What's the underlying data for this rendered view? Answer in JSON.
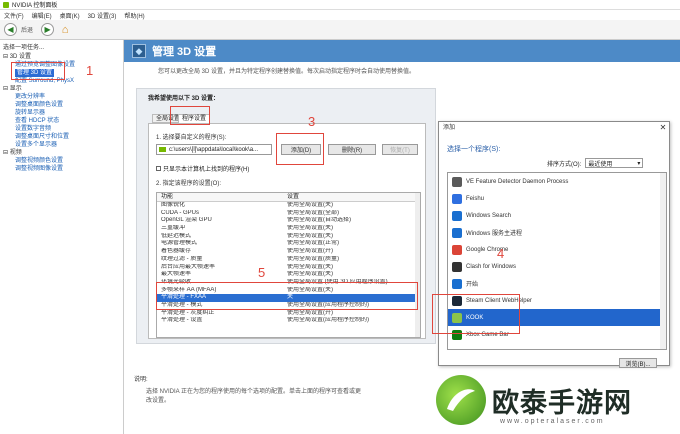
{
  "window": {
    "title": "NVIDIA 控制面板"
  },
  "menu": [
    "文件(F)",
    "编辑(E)",
    "桌面(K)",
    "3D 设置(3)",
    "帮助(H)"
  ],
  "toolbar": {
    "back_label": "后退",
    "forward_label": ""
  },
  "sidebar": {
    "title": "选择一项任务...",
    "items": [
      {
        "label": "3D 设置",
        "kind": "cat"
      },
      {
        "label": "通过预览调整图像设置",
        "kind": "link"
      },
      {
        "label": "管理 3D 设置",
        "kind": "selected"
      },
      {
        "label": "配置 Surround, PhysX",
        "kind": "link"
      },
      {
        "label": "显示",
        "kind": "cat"
      },
      {
        "label": "更改分辨率",
        "kind": "link"
      },
      {
        "label": "调整桌面颜色设置",
        "kind": "link"
      },
      {
        "label": "旋转显示器",
        "kind": "link"
      },
      {
        "label": "查看 HDCP 状态",
        "kind": "link"
      },
      {
        "label": "设置数字音频",
        "kind": "link"
      },
      {
        "label": "调整桌面尺寸和位置",
        "kind": "link"
      },
      {
        "label": "设置多个显示器",
        "kind": "link"
      },
      {
        "label": "视频",
        "kind": "cat"
      },
      {
        "label": "调整视频颜色设置",
        "kind": "link"
      },
      {
        "label": "调整视频图像设置",
        "kind": "link"
      }
    ]
  },
  "banner": {
    "title": "管理 3D 设置"
  },
  "description": "您可以更改全局 3D 设置，并且为特定程序创建替换值。每次启动指定程序时会自动使用替换值。",
  "panel": {
    "title": "我希望使用以下 3D 设置：",
    "tabs": [
      "全局设置",
      "程序设置"
    ],
    "step1": "1. 选择要自定义的程序(S):",
    "program_value": "c:\\users\\[l]\\appdata\\local\\kook\\a...",
    "add_label": "添加(D)",
    "remove_label": "删除(R)",
    "restore_label": "恢复(T)",
    "show_only": "只显示本计算机上找到的程序(H)",
    "step2": "2. 指定该程序的设置(O):",
    "col_feature": "功能",
    "col_setting": "设置",
    "rows": [
      {
        "f": "图像锐化",
        "s": "使用全局设置(关)"
      },
      {
        "f": "CUDA - GPUs",
        "s": "使用全局设置(全部)"
      },
      {
        "f": "OpenGL 渲染 GPU",
        "s": "使用全局设置(自动选择)"
      },
      {
        "f": "三重缓冲",
        "s": "使用全局设置(关)"
      },
      {
        "f": "低延迟模式",
        "s": "使用全局设置(关)"
      },
      {
        "f": "电源管理模式",
        "s": "使用全局设置(正常)"
      },
      {
        "f": "着色器缓存",
        "s": "使用全局设置(开)"
      },
      {
        "f": "纹理过滤 - 质量",
        "s": "使用全局设置(质量)"
      },
      {
        "f": "后台应用最大帧速率",
        "s": "使用全局设置(关)"
      },
      {
        "f": "最大帧速率",
        "s": "使用全局设置(关)"
      },
      {
        "f": "环境光吸收",
        "s": "使用全局设置 (使用 3D 应用程序设置)"
      },
      {
        "f": "多帧采样 AA (MFAA)",
        "s": "使用全局设置(关)"
      },
      {
        "f": "平滑处理 - FXAA",
        "s": "关"
      },
      {
        "f": "平滑处理 - 模式",
        "s": "使用全局设置(应用程序控制的)"
      },
      {
        "f": "平滑处理 - 灰度纠正",
        "s": "使用全局设置(开)"
      },
      {
        "f": "平滑处理 - 设置",
        "s": "使用全局设置(应用程序控制的)"
      }
    ],
    "highlight_index": 12
  },
  "explain": {
    "title": "说明:",
    "text": "选择 NVIDIA 正在为您的程序使用的每个选项的配置。单击上面的程序可查看或更改设置。"
  },
  "dialog": {
    "title": "添加",
    "heading": "选择一个程序(S):",
    "sort_label": "排序方式(O):",
    "sort_value": "最近使用",
    "programs": [
      {
        "name": "VE Feature Detector Daemon Process",
        "icon": "gear-icon",
        "color": "#5a5a5a"
      },
      {
        "name": "Feishu",
        "icon": "feishu-icon",
        "color": "#2f6fe0"
      },
      {
        "name": "Windows Search",
        "icon": "windows-icon",
        "color": "#1a6fd0"
      },
      {
        "name": "Windows 服务主进程",
        "icon": "windows-icon",
        "color": "#1a6fd0"
      },
      {
        "name": "Google Chrome",
        "icon": "chrome-icon",
        "color": "#db4437"
      },
      {
        "name": "Clash for Windows",
        "icon": "cat-icon",
        "color": "#333"
      },
      {
        "name": "开始",
        "icon": "windows-icon",
        "color": "#1a6fd0"
      },
      {
        "name": "Steam Client WebHelper",
        "icon": "steam-icon",
        "color": "#1b2838"
      },
      {
        "name": "KOOK",
        "icon": "kook-icon",
        "color": "#8bc34a"
      },
      {
        "name": "Xbox Game Bar",
        "icon": "xbox-icon",
        "color": "#107c10"
      }
    ],
    "selected_index": 8,
    "browse_label": "浏览(B)..."
  },
  "annotations": [
    "1",
    "3",
    "4",
    "5"
  ],
  "watermark": {
    "text": "欧泰手游网",
    "url": "www.opteralaser.com"
  }
}
